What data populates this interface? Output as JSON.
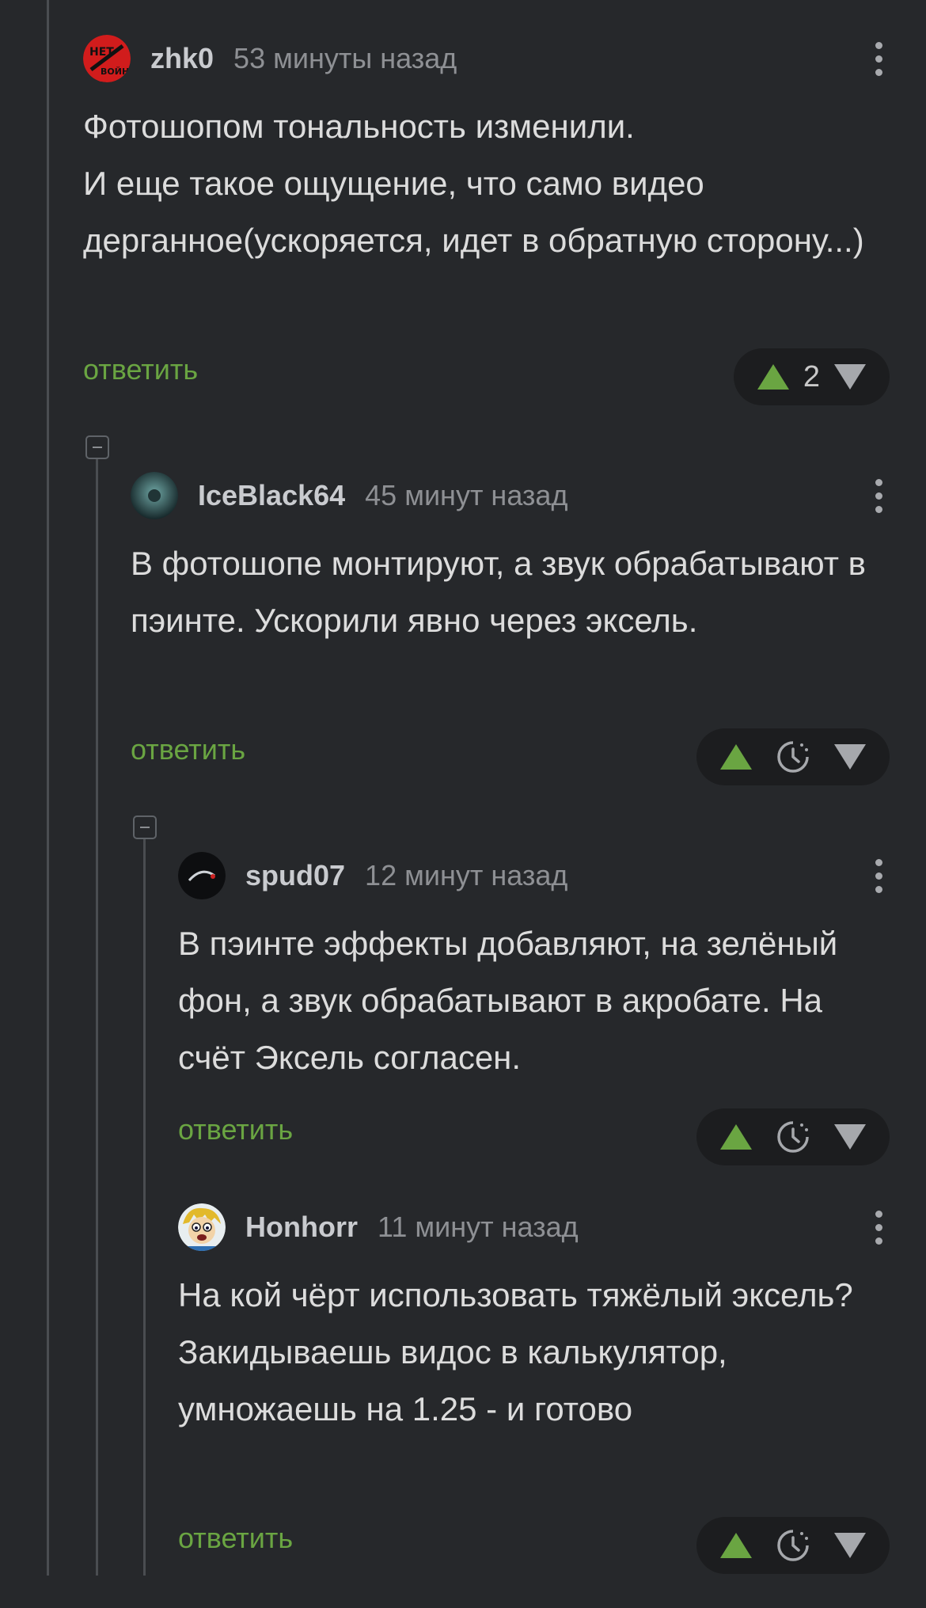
{
  "comments": [
    {
      "username": "zhk0",
      "time": "53 минуты назад",
      "text": "Фотошопом тональность изменили.\nИ еще такое ощущение, что само видео дерганное(ускоряется, идет в обратную сторону...)",
      "reply": "ответить",
      "rating": "2",
      "avatar_icon": "red-logo-avatar"
    },
    {
      "username": "IceBlack64",
      "time": "45 минут назад",
      "text": "В фотошопе монтируют, а звук обрабатывают в пэинте. Ускорили явно через эксель.",
      "reply": "ответить",
      "avatar_icon": "dark-teal-avatar"
    },
    {
      "username": "spud07",
      "time": "12 минут назад",
      "text": "В пэинте эффекты добавляют, на зелёный фон, а звук обрабатывают в акробате. На счёт Эксель согласен.",
      "reply": "ответить",
      "avatar_icon": "dark-avatar"
    },
    {
      "username": "Honhorr",
      "time": "11 минут назад",
      "text": "На кой чёрт использовать тяжёлый эксель?\nЗакидываешь видос в калькулятор, умножаешь на 1.25 - и готово",
      "reply": "ответить",
      "avatar_icon": "cartoon-boy-avatar"
    }
  ],
  "colors": {
    "background": "#26282b",
    "accent_green": "#6aa542",
    "upvote": "#6aa542",
    "downvote": "#a6a8ac"
  }
}
